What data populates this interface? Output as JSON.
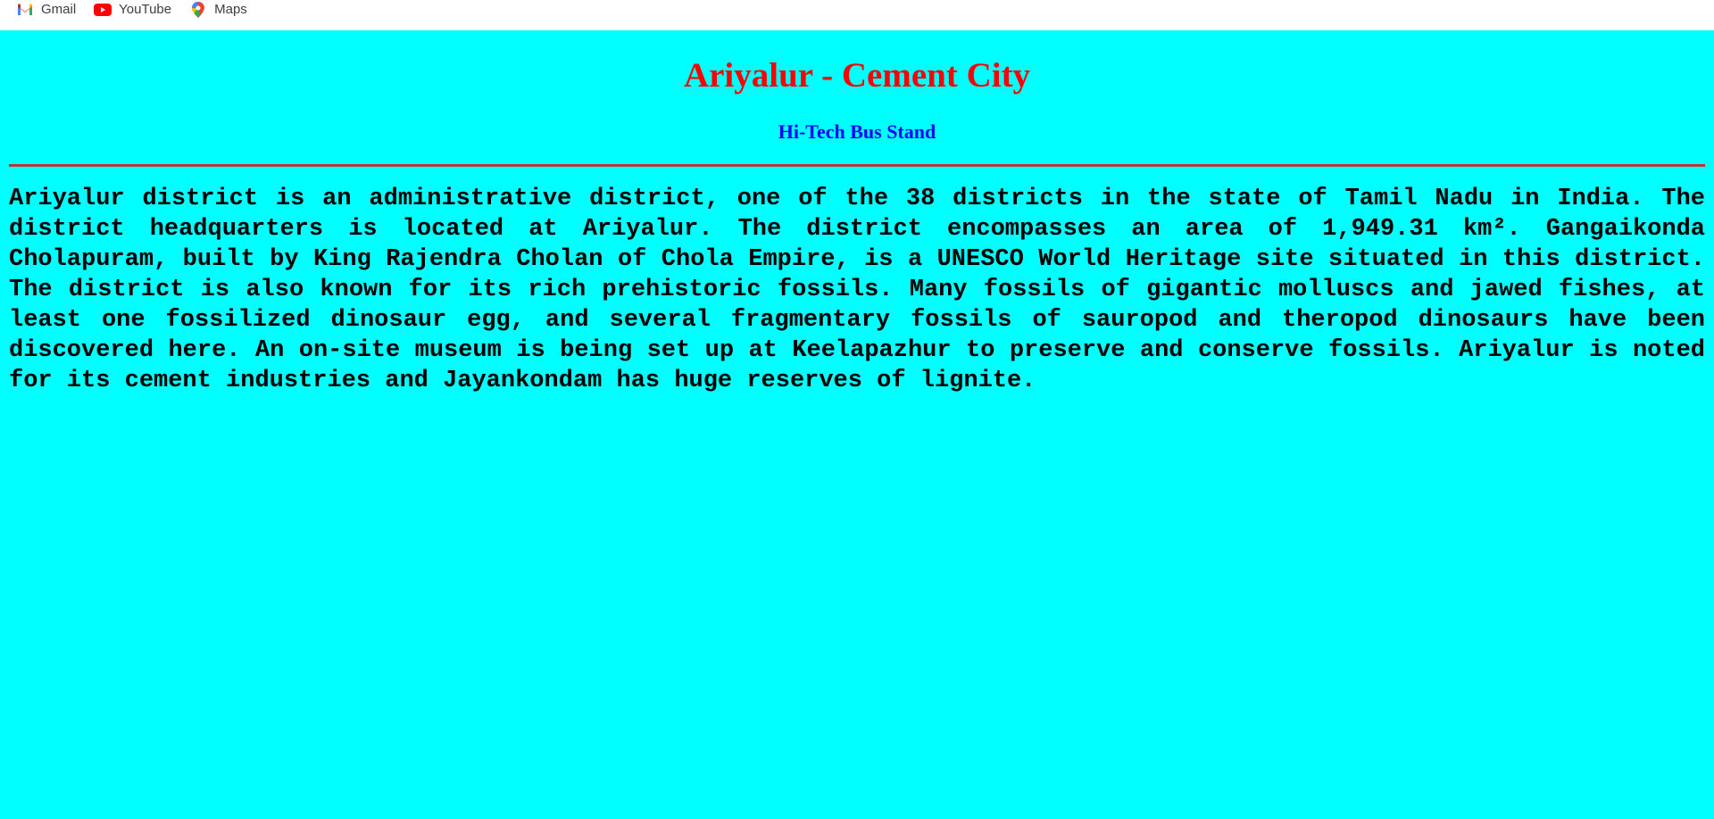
{
  "bookmarks": [
    {
      "label": "Gmail",
      "icon": "gmail-icon"
    },
    {
      "label": "YouTube",
      "icon": "youtube-icon"
    },
    {
      "label": "Maps",
      "icon": "maps-icon"
    }
  ],
  "page": {
    "title": "Ariyalur - Cement City",
    "subtitle": "Hi-Tech Bus Stand",
    "body": "Ariyalur district is an administrative district, one of the 38 districts in the state of Tamil Nadu in India. The district headquarters is located at Ariyalur. The district encompasses an area of 1,949.31 km². Gangaikonda Cholapuram, built by King Rajendra Cholan of Chola Empire, is a UNESCO World Heritage site situated in this district. The district is also known for its rich prehistoric fossils. Many fossils of gigantic molluscs and jawed fishes, at least one fossilized dinosaur egg, and several fragmentary fossils of sauropod and theropod dinosaurs have been discovered here. An on-site museum is being set up at Keelapazhur to preserve and conserve fossils. Ariyalur is noted for its cement industries and Jayankondam has huge reserves of lignite."
  },
  "colors": {
    "background": "#00ffff",
    "title": "#ff0000",
    "subtitle": "#0000ff",
    "divider": "#dd2222",
    "text": "#000000"
  }
}
